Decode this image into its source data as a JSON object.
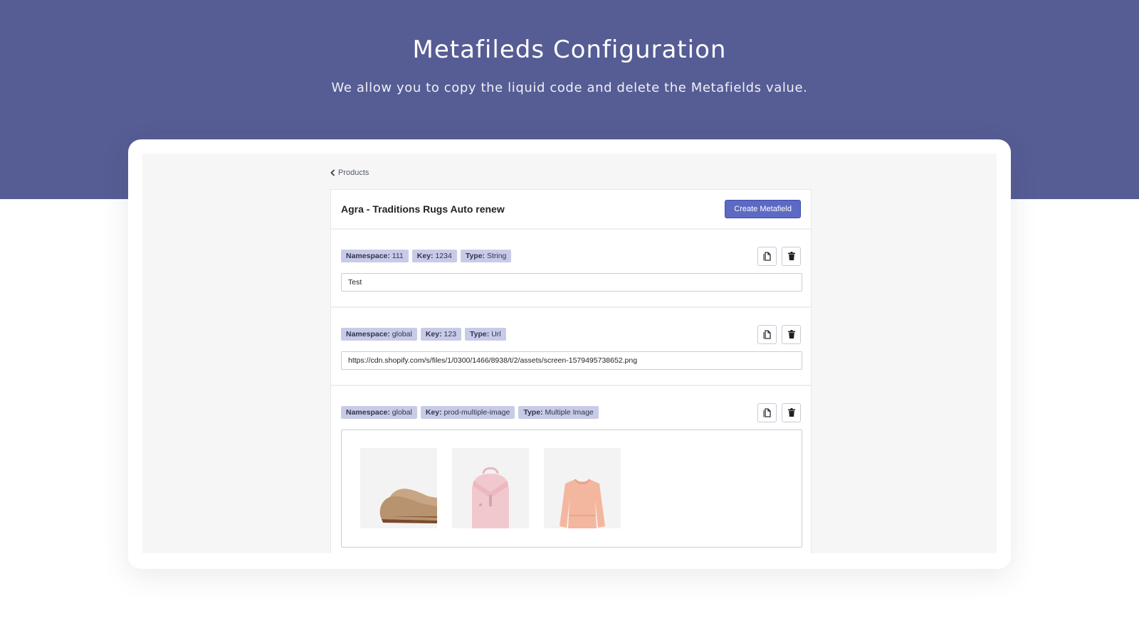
{
  "hero": {
    "title": "Metafileds Configuration",
    "subtitle": "We allow you to copy the liquid code and delete the Metafields value."
  },
  "breadcrumb": {
    "label": "Products"
  },
  "product": {
    "title": "Agra - Traditions Rugs Auto renew",
    "create_label": "Create Metafield"
  },
  "metafields": [
    {
      "namespace_label": "Namespace:",
      "namespace": "111",
      "key_label": "Key:",
      "key": "1234",
      "type_label": "Type:",
      "type": "String",
      "value": "Test"
    },
    {
      "namespace_label": "Namespace:",
      "namespace": "global",
      "key_label": "Key:",
      "key": "123",
      "type_label": "Type:",
      "type": "Url",
      "value": "https://cdn.shopify.com/s/files/1/0300/1466/8938/t/2/assets/screen-1579495738652.png"
    },
    {
      "namespace_label": "Namespace:",
      "namespace": "global",
      "key_label": "Key:",
      "key": "prod-multiple-image",
      "type_label": "Type:",
      "type": "Multiple Image",
      "images": [
        "shoes",
        "backpack",
        "blouse"
      ]
    }
  ],
  "icons": {
    "copy": "copy-icon",
    "delete": "trash-icon",
    "back": "chevron-left-icon"
  },
  "colors": {
    "hero_bg": "#565d94",
    "accent": "#5c6ac4",
    "tag_bg": "#c8cbe8"
  }
}
